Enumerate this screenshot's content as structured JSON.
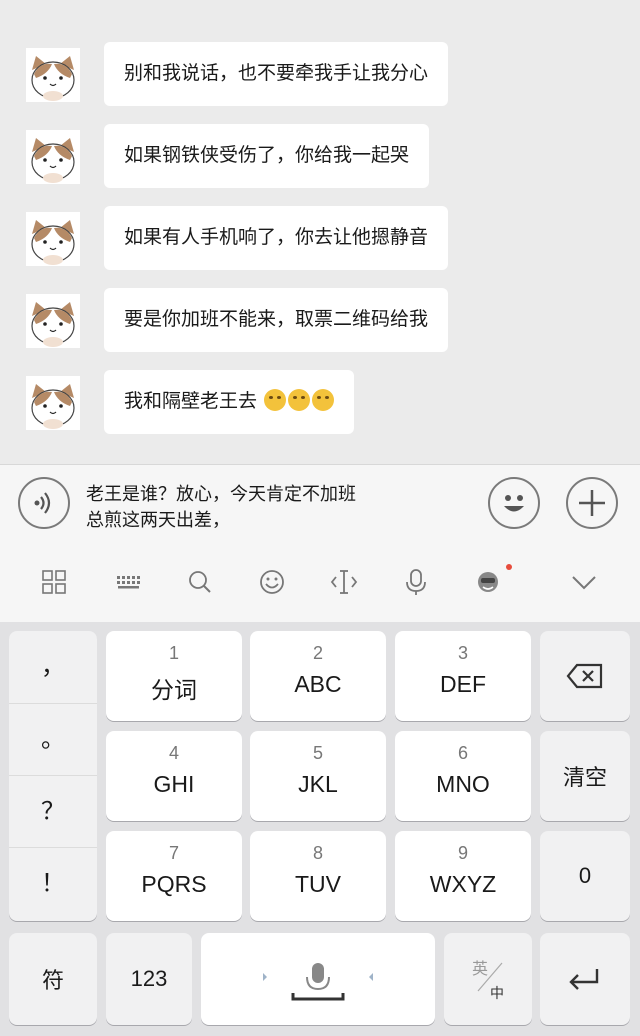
{
  "messages": [
    {
      "text": "别和我说话，也不要牵我手让我分心",
      "emojis": 0
    },
    {
      "text": "如果钢铁侠受伤了，你给我一起哭",
      "emojis": 0
    },
    {
      "text": "如果有人手机响了，你去让他摁静音",
      "emojis": 0
    },
    {
      "text": "要是你加班不能来，取票二维码给我",
      "emojis": 0
    },
    {
      "text": "我和隔壁老王去",
      "emojis": 3
    }
  ],
  "input": {
    "line1": "老王是谁？放心，今天肯定不加班",
    "line2": "总煎这两天出差，"
  },
  "toolbar": {
    "icons": [
      "grid-icon",
      "keyboard-icon",
      "search-icon",
      "emoji-icon",
      "cursor-icon",
      "microphone-icon",
      "skin-icon",
      "collapse-chevron-icon"
    ]
  },
  "keyboard": {
    "punctuation": [
      "，",
      "。",
      "？",
      "！"
    ],
    "keys": [
      {
        "num": "1",
        "letters": "分词"
      },
      {
        "num": "2",
        "letters": "ABC"
      },
      {
        "num": "3",
        "letters": "DEF"
      },
      {
        "num": "4",
        "letters": "GHI"
      },
      {
        "num": "5",
        "letters": "JKL"
      },
      {
        "num": "6",
        "letters": "MNO"
      },
      {
        "num": "7",
        "letters": "PQRS"
      },
      {
        "num": "8",
        "letters": "TUV"
      },
      {
        "num": "9",
        "letters": "WXYZ"
      }
    ],
    "clear_label": "清空",
    "zero_label": "0",
    "symbol_label": "符",
    "num_label": "123",
    "lang_top": "英",
    "lang_bottom": "中"
  },
  "colors": {
    "chat_bg": "#ebebeb",
    "bubble_bg": "#ffffff",
    "keyboard_bg": "#e1e1e3",
    "badge_red": "#e74c3c"
  }
}
